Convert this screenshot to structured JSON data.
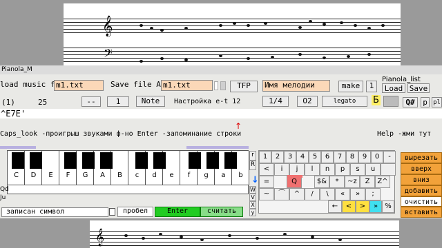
{
  "title_bar": {
    "title": "Pianola_M",
    "list_title": "Pianola_list"
  },
  "toolbar": {
    "load_label": "load music file",
    "load_value": "m1.txt",
    "save_label": "Save file As",
    "save_value": "m1.txt",
    "tfp_button": "TFP",
    "melody_name": "Имя мелодии",
    "make_button": "make",
    "one_button": "1",
    "load_btn": "Load",
    "save_btn": "Save"
  },
  "row2": {
    "counter": "(1)",
    "value": "25",
    "dash_button": "--",
    "one_button": "1",
    "note_button": "Note",
    "settings_label": "Настройка е-t 12",
    "quarter_button": "1/4",
    "o2_button": "O2",
    "legato_button": "legato",
    "b_label": "Б",
    "q_button": "Q#",
    "p_button": "p",
    "pl_button": "pl"
  },
  "edit_text": "^E7E'",
  "help": {
    "caps_text": "Caps_look -проигрыш звуками ф-но  Enter -запоминание строки",
    "help_text": "Help -жми тут",
    "arrow_up": "↑",
    "arrow_down": "↓"
  },
  "piano": {
    "white_keys": [
      "C",
      "D",
      "E",
      "F",
      "G",
      "A",
      "B",
      "c",
      "d",
      "e",
      "f",
      "g",
      "a",
      "b"
    ],
    "side_top": "r",
    "side_top2": "R",
    "side_letters": [
      "W",
      "V",
      "X",
      "y"
    ],
    "left_labels": [
      "Qd",
      "Ju"
    ]
  },
  "grid": {
    "row1": [
      "1",
      "2",
      "3",
      "4",
      "5",
      "6",
      "7",
      "8",
      "9",
      "0",
      "-"
    ],
    "row2": [
      "<",
      "i",
      "j",
      "l",
      "n",
      "p",
      "s",
      "u",
      ""
    ],
    "row3": [
      "=",
      "Q",
      "$&",
      "*",
      "~z",
      "Z",
      "Z^"
    ],
    "row4": [
      "~",
      "⁀",
      "^",
      "/",
      "\\",
      "«",
      "»",
      ";"
    ],
    "row5": [
      "←",
      "<",
      ">",
      "»",
      "%"
    ]
  },
  "actions": [
    "вырезать",
    "вверх",
    "вниз",
    "добавить",
    "очистить",
    "вставить"
  ],
  "status": {
    "written": "записан символ",
    "space": "пробел",
    "enter": "Enter",
    "read": "считать"
  },
  "colors": {
    "field": "#fbd8b8",
    "enter_green": "#22cc22",
    "action_orange": "#f2a23a",
    "blue_arrow": "#0060ff"
  }
}
